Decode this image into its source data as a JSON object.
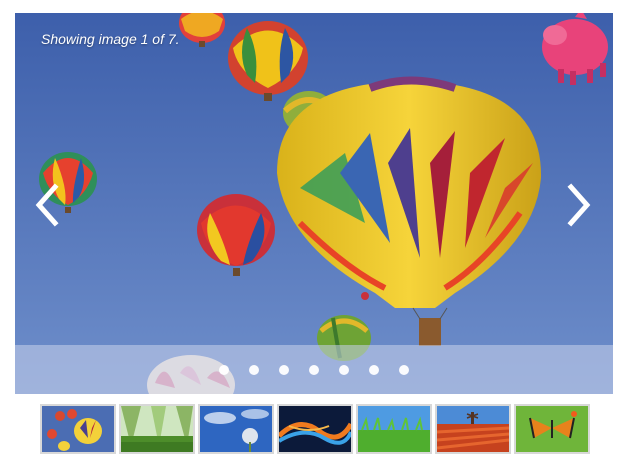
{
  "gallery": {
    "caption": "Showing image 1 of 7.",
    "current_index": 1,
    "total": 7,
    "main_image": "hot-air-balloons-blue-sky",
    "prev_icon": "chevron-left-icon",
    "next_icon": "chevron-right-icon",
    "dots": [
      {
        "name": "slide-dot-1"
      },
      {
        "name": "slide-dot-2"
      },
      {
        "name": "slide-dot-3"
      },
      {
        "name": "slide-dot-4"
      },
      {
        "name": "slide-dot-5"
      },
      {
        "name": "slide-dot-6"
      },
      {
        "name": "slide-dot-7"
      }
    ],
    "thumbnails": [
      {
        "name": "thumbnail-balloons",
        "subject": "hot air balloons"
      },
      {
        "name": "thumbnail-forest",
        "subject": "green forest"
      },
      {
        "name": "thumbnail-dandelion",
        "subject": "dandelion and sky"
      },
      {
        "name": "thumbnail-abstract-light",
        "subject": "abstract light streaks"
      },
      {
        "name": "thumbnail-grass",
        "subject": "grass and sky"
      },
      {
        "name": "thumbnail-tulip-field",
        "subject": "tulip field with windmill"
      },
      {
        "name": "thumbnail-butterfly",
        "subject": "monarch butterfly"
      }
    ],
    "colors": {
      "sky_top": "#3a5da8",
      "sky_bottom": "#7a9ad0",
      "dot_bar": "#c8d2eb",
      "thumb_border": "#d8d8d8"
    }
  }
}
